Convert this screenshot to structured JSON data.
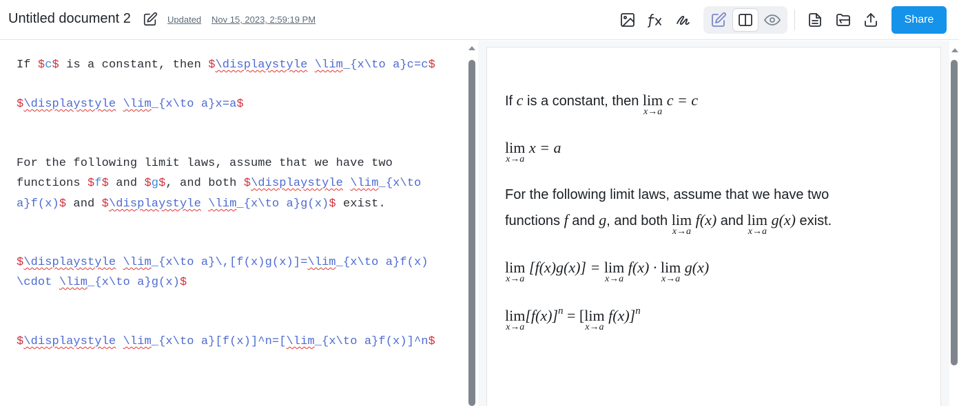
{
  "header": {
    "doc_title": "Untitled document 2",
    "updated_label": "Updated",
    "updated_date": "Nov 15, 2023, 2:59:19 PM",
    "share_label": "Share",
    "toolbar_icons": [
      "image-icon",
      "formula-icon",
      "signature-icon",
      "edit-mode-icon",
      "split-view-icon",
      "preview-mode-icon",
      "document-icon",
      "folder-icon",
      "upload-icon"
    ],
    "accent_color": "#1592ea"
  },
  "editor": {
    "lines": [
      {
        "prefix": "If ",
        "parts": [
          [
            "dollar",
            "$"
          ],
          [
            "var",
            "c"
          ],
          [
            "dollar",
            "$"
          ],
          [
            "plain",
            " is a constant, then "
          ],
          [
            "dollar",
            "$"
          ],
          [
            "cmd",
            "\\displaystyle"
          ],
          [
            "plain",
            " "
          ],
          [
            "cmd",
            "\\lim"
          ],
          [
            "math",
            "_{x\\to a}c=c"
          ],
          [
            "dollar",
            "$"
          ]
        ]
      },
      {
        "prefix": "",
        "parts": [
          [
            "dollar",
            "$"
          ],
          [
            "cmd",
            "\\displaystyle"
          ],
          [
            "plain",
            " "
          ],
          [
            "cmd",
            "\\lim"
          ],
          [
            "math",
            "_{x\\to a}x=a"
          ],
          [
            "dollar",
            "$"
          ]
        ]
      },
      {
        "prefix": "For the following limit laws, assume that we have two",
        "parts": []
      },
      {
        "prefix": "functions ",
        "parts": [
          [
            "dollar",
            "$"
          ],
          [
            "var",
            "f"
          ],
          [
            "dollar",
            "$"
          ],
          [
            "plain",
            " and "
          ],
          [
            "dollar",
            "$"
          ],
          [
            "var",
            "g"
          ],
          [
            "dollar",
            "$"
          ],
          [
            "plain",
            ", and both "
          ],
          [
            "dollar",
            "$"
          ],
          [
            "cmd",
            "\\displaystyle"
          ],
          [
            "plain",
            " "
          ],
          [
            "cmd",
            "\\lim"
          ],
          [
            "math",
            "_{x\\to"
          ]
        ]
      },
      {
        "prefix": "",
        "parts": [
          [
            "math",
            "a}f(x)"
          ],
          [
            "dollar",
            "$"
          ],
          [
            "plain",
            " and "
          ],
          [
            "dollar",
            "$"
          ],
          [
            "cmd",
            "\\displaystyle"
          ],
          [
            "plain",
            " "
          ],
          [
            "cmd",
            "\\lim"
          ],
          [
            "math",
            "_{x\\to a}g(x)"
          ],
          [
            "dollar",
            "$"
          ],
          [
            "plain",
            " exist."
          ]
        ]
      },
      {
        "prefix": "",
        "parts": [
          [
            "dollar",
            "$"
          ],
          [
            "cmd",
            "\\displaystyle"
          ],
          [
            "plain",
            " "
          ],
          [
            "cmd",
            "\\lim"
          ],
          [
            "math",
            "_{x\\to a}\\,[f(x)g(x)]="
          ],
          [
            "cmd",
            "\\lim"
          ],
          [
            "math",
            "_{x\\to a}f(x)"
          ]
        ]
      },
      {
        "prefix": "",
        "parts": [
          [
            "math",
            "\\cdot "
          ],
          [
            "cmd",
            "\\lim"
          ],
          [
            "math",
            "_{x\\to a}g(x)"
          ],
          [
            "dollar",
            "$"
          ]
        ]
      },
      {
        "prefix": "",
        "parts": [
          [
            "dollar",
            "$"
          ],
          [
            "cmd",
            "\\displaystyle"
          ],
          [
            "plain",
            " "
          ],
          [
            "cmd",
            "\\lim"
          ],
          [
            "math",
            "_{x\\to a}[f(x)]^n=["
          ],
          [
            "cmd",
            "\\lim"
          ],
          [
            "math",
            "_{x\\to a}f(x)]^n"
          ],
          [
            "dollar",
            "$"
          ]
        ]
      }
    ]
  },
  "preview": {
    "line1_text": "If ",
    "line1_var": "c",
    "line1_mid": " is a constant, then ",
    "lim": "lim",
    "sub_x_to_a": "x→a",
    "line1_expr": "c = c",
    "line2_expr": "x = a",
    "line3_text": "For the following limit laws, assume that we have two",
    "line4_a": "functions ",
    "line4_f": "f",
    "line4_and": " and ",
    "line4_g": "g",
    "line4_both": ", and both ",
    "line4_fx": "f(x)",
    "line4_and2": " and ",
    "line4_gx": "g(x)",
    "line4_exist": " exist.",
    "line5_lhs": "[f(x)g(x)] =",
    "line5_f": "f(x) ·",
    "line5_g": "g(x)",
    "line6_lhs": "[f(x)]",
    "line6_n": "n",
    "line6_eq": " = [",
    "line6_f": "f(x)]",
    "line6_n2": "n"
  }
}
